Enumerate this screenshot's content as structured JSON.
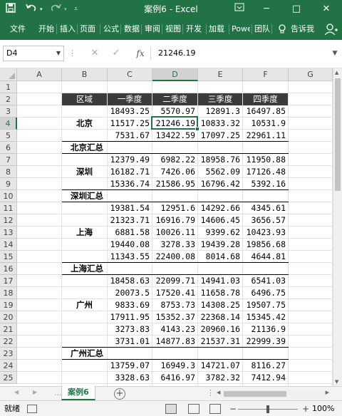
{
  "titlebar": {
    "save_icon": "save-icon",
    "undo_icon": "undo-icon",
    "redo_icon": "redo-icon",
    "customize_icon": "customize-quick-access-icon",
    "title": "案例6  -  Excel",
    "minimize": "─",
    "maximize": "□",
    "close": "✕",
    "options_icon": "ribbon-display-options-icon"
  },
  "ribbon": {
    "tabs": [
      "文件",
      "开始",
      "插入",
      "页面",
      "公式",
      "数据",
      "审阅",
      "视图",
      "开发",
      "加载",
      "Powe",
      "团队"
    ],
    "tell_me": "告诉我",
    "lightbulb_icon": "lightbulb-icon",
    "account_icon": "account-icon"
  },
  "formula_bar": {
    "name_box": "D4",
    "cancel": "✕",
    "enter": "✓",
    "fx": "fx",
    "value": "21246.19"
  },
  "columns": [
    "A",
    "B",
    "C",
    "D",
    "E",
    "F",
    "G"
  ],
  "rows": [
    "1",
    "2",
    "3",
    "4",
    "5",
    "6",
    "7",
    "8",
    "9",
    "10",
    "11",
    "12",
    "13",
    "14",
    "15",
    "16",
    "17",
    "18",
    "19",
    "20",
    "21",
    "22",
    "23",
    "24",
    "25"
  ],
  "table": {
    "headers": [
      "区域",
      "一季度",
      "二季度",
      "三季度",
      "四季度"
    ],
    "groups": [
      {
        "region": "北京",
        "rows": [
          [
            "18493.25",
            "5570.97",
            "12891.3",
            "16497.85"
          ],
          [
            "11517.25",
            "21246.19",
            "10833.32",
            "10531.9"
          ],
          [
            "7531.67",
            "13422.59",
            "17097.25",
            "22961.11"
          ]
        ],
        "subtotal": "北京汇总"
      },
      {
        "region": "深圳",
        "rows": [
          [
            "12379.49",
            "6982.22",
            "18958.76",
            "11950.88"
          ],
          [
            "16182.71",
            "7426.06",
            "5562.09",
            "17126.48"
          ],
          [
            "15336.74",
            "21586.95",
            "16796.42",
            "5392.16"
          ]
        ],
        "subtotal": "深圳汇总"
      },
      {
        "region": "上海",
        "rows": [
          [
            "19381.54",
            "12951.6",
            "14292.66",
            "4345.61"
          ],
          [
            "21323.71",
            "16916.79",
            "14606.45",
            "3656.57"
          ],
          [
            "6881.58",
            "10026.11",
            "9399.62",
            "10423.93"
          ],
          [
            "19440.08",
            "3278.33",
            "19439.28",
            "19856.68"
          ],
          [
            "11343.55",
            "22400.08",
            "8014.68",
            "4644.81"
          ]
        ],
        "subtotal": "上海汇总"
      },
      {
        "region": "广州",
        "rows": [
          [
            "18458.63",
            "22099.71",
            "14941.03",
            "6541.03"
          ],
          [
            "20073.5",
            "17520.41",
            "11658.78",
            "6496.75"
          ],
          [
            "9833.69",
            "8753.73",
            "14308.25",
            "19507.75"
          ],
          [
            "17911.95",
            "15352.37",
            "22368.14",
            "15345.42"
          ],
          [
            "3273.83",
            "4143.23",
            "20960.16",
            "21136.9"
          ],
          [
            "3731.01",
            "14877.83",
            "21537.31",
            "22999.39"
          ]
        ],
        "subtotal": "广州汇总"
      },
      {
        "region": "",
        "rows": [
          [
            "13759.07",
            "16949.3",
            "14721.07",
            "8116.27"
          ],
          [
            "3328.63",
            "6416.97",
            "3782.32",
            "7412.94"
          ]
        ],
        "subtotal": ""
      }
    ]
  },
  "sheets": {
    "prev_icon": "◀",
    "next_icon": "▶",
    "more": "...",
    "active": "案例6",
    "add": "+"
  },
  "status": {
    "ready": "就绪",
    "zoom_out": "−",
    "zoom_in": "+",
    "zoom": "100%"
  }
}
